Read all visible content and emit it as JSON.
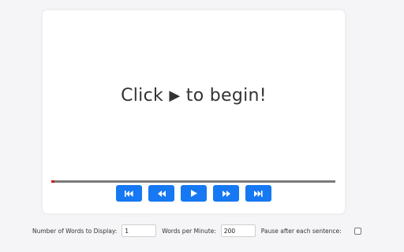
{
  "reader": {
    "prompt_prefix": "Click",
    "prompt_glyph": "▶",
    "prompt_suffix": "to begin!",
    "progress_fraction": 0.01,
    "progress_color": "#d21a1a",
    "track_color": "#7a7a7a"
  },
  "controls": [
    {
      "name": "skip-to-start-button",
      "icon": "skip-back-icon"
    },
    {
      "name": "rewind-button",
      "icon": "rewind-icon"
    },
    {
      "name": "play-button",
      "icon": "play-icon"
    },
    {
      "name": "fast-forward-button",
      "icon": "fast-forward-icon"
    },
    {
      "name": "skip-to-end-button",
      "icon": "skip-forward-icon"
    }
  ],
  "accent_color": "#1678f2",
  "settings": {
    "words_to_display_label": "Number of Words to Display:",
    "words_to_display_value": "1",
    "wpm_label": "Words per Minute:",
    "wpm_value": "200",
    "pause_label": "Pause after each sentence:",
    "pause_checked": false
  }
}
